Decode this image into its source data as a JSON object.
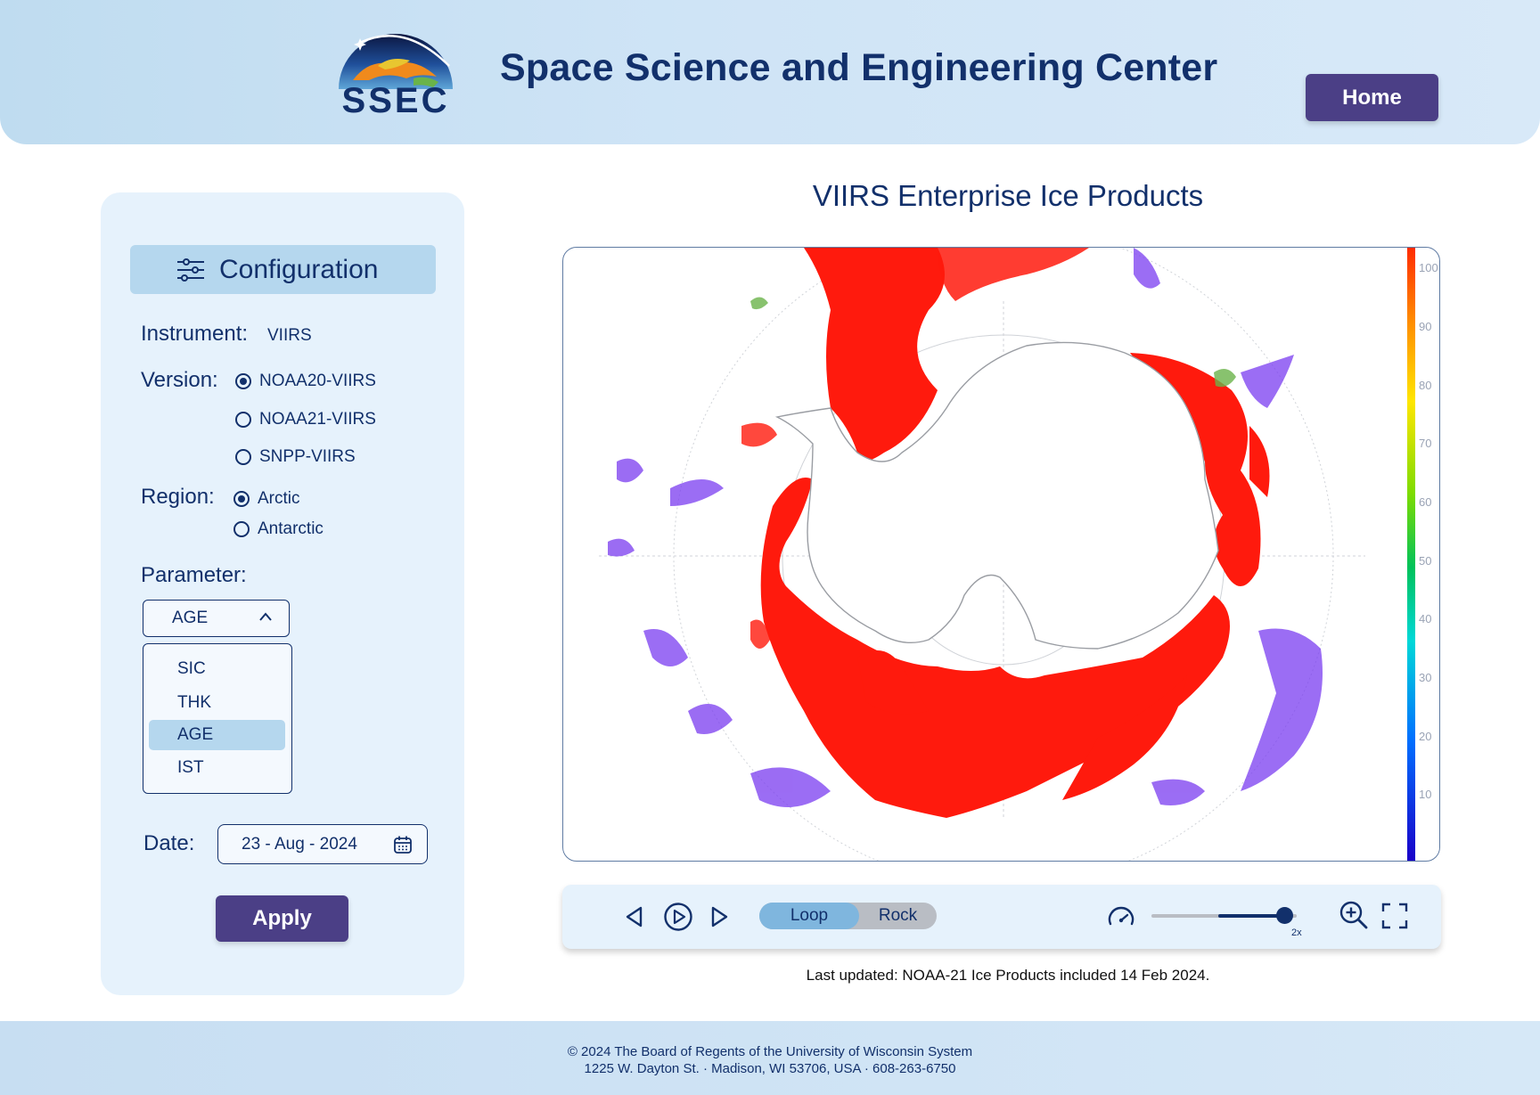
{
  "header": {
    "logo_text": "SSEC",
    "site_title": "Space Science and Engineering Center",
    "home_label": "Home"
  },
  "config": {
    "title": "Configuration",
    "instrument_label": "Instrument:",
    "instrument_value": "VIIRS",
    "version_label": "Version:",
    "versions": [
      {
        "label": "NOAA20-VIIRS",
        "selected": true
      },
      {
        "label": "NOAA21-VIIRS",
        "selected": false
      },
      {
        "label": "SNPP-VIIRS",
        "selected": false
      }
    ],
    "region_label": "Region:",
    "regions": [
      {
        "label": "Arctic",
        "selected": true
      },
      {
        "label": "Antarctic",
        "selected": false
      }
    ],
    "parameter_label": "Parameter:",
    "parameter_selected": "AGE",
    "parameter_options": [
      "SIC",
      "THK",
      "AGE",
      "IST"
    ],
    "date_label": "Date:",
    "date_value": "23 - Aug - 2024",
    "apply_label": "Apply"
  },
  "main": {
    "title": "VIIRS Enterprise Ice Products",
    "colorbar_ticks": [
      "100",
      "90",
      "80",
      "70",
      "60",
      "50",
      "40",
      "30",
      "20",
      "10"
    ],
    "colors": {
      "ice": "#ff1a0d",
      "low": "#7a3cf0",
      "accent": "#4b3f86",
      "text": "#12306b"
    }
  },
  "controls": {
    "loop_label": "Loop",
    "rock_label": "Rock",
    "speed_label": "2x",
    "speed_fraction": 0.92,
    "icons": [
      "prev-icon",
      "play-icon",
      "next-icon",
      "speed-icon",
      "zoom-in-icon",
      "fullscreen-icon"
    ]
  },
  "status": {
    "last_updated": "Last updated: NOAA-21 Ice Products included 14 Feb 2024."
  },
  "footer": {
    "line1": "© 2024 The Board of Regents of the University of Wisconsin System",
    "line2": "1225 W. Dayton St. · Madison, WI 53706, USA · 608-263-6750"
  }
}
